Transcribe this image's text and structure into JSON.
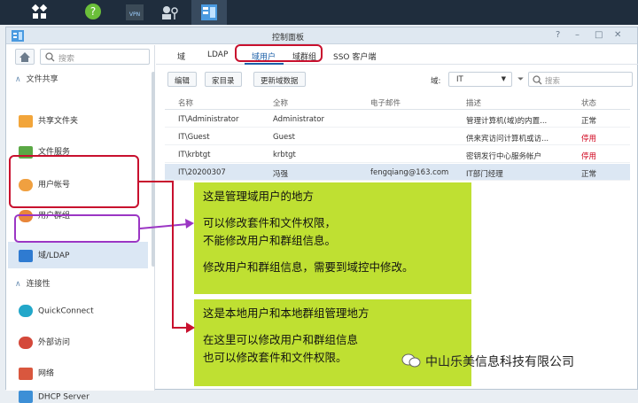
{
  "window": {
    "title": "控制面板"
  },
  "sidebar": {
    "search_placeholder": "搜索",
    "sections": [
      {
        "label": "文件共享"
      },
      {
        "label": "连接性"
      }
    ],
    "items": [
      {
        "label": "共享文件夹"
      },
      {
        "label": "文件服务"
      },
      {
        "label": "用户帐号"
      },
      {
        "label": "用户群组"
      },
      {
        "label": "域/LDAP"
      },
      {
        "label": "QuickConnect"
      },
      {
        "label": "外部访问"
      },
      {
        "label": "网络"
      },
      {
        "label": "DHCP Server"
      }
    ]
  },
  "tabs": [
    {
      "label": "域"
    },
    {
      "label": "LDAP"
    },
    {
      "label": "域用户"
    },
    {
      "label": "域群组"
    },
    {
      "label": "SSO 客户端"
    }
  ],
  "toolbar": {
    "edit": "编辑",
    "home_dir": "家目录",
    "update": "更新域数据",
    "domain_label": "域:",
    "domain_value": "IT",
    "search_placeholder": "搜索"
  },
  "table": {
    "columns": [
      "名称",
      "全称",
      "电子邮件",
      "描述",
      "状态"
    ],
    "rows": [
      {
        "name": "IT\\Administrator",
        "full": "Administrator",
        "email": "",
        "desc": "管理计算机(域)的内置...",
        "status": "正常",
        "status_color": "#333333"
      },
      {
        "name": "IT\\Guest",
        "full": "Guest",
        "email": "",
        "desc": "供来宾访问计算机或访...",
        "status": "停用",
        "status_color": "#d0021b"
      },
      {
        "name": "IT\\krbtgt",
        "full": "krbtgt",
        "email": "",
        "desc": "密钥发行中心服务帐户",
        "status": "停用",
        "status_color": "#d0021b"
      },
      {
        "name": "IT\\20200307",
        "full": "冯强",
        "email": "fengqiang@163.com",
        "desc": "IT部门经理",
        "status": "正常",
        "status_color": "#333333"
      }
    ]
  },
  "callouts": {
    "top": [
      "这是管理域用户的地方",
      "",
      "可以修改套件和文件权限，",
      "不能修改用户和群组信息。",
      "",
      "修改用户和群组信息，需要到域控中修改。"
    ],
    "bottom": [
      "这是本地用户和本地群组管理地方",
      "",
      "在这里可以修改用户和群组信息",
      "也可以修改套件和文件权限。"
    ]
  },
  "watermark": "中山乐美信息科技有限公司",
  "colors": {
    "callout_bg": "#bfe032",
    "annot_red": "#c8102e",
    "annot_purple": "#9b36c4",
    "accent": "#1b5fa8"
  }
}
